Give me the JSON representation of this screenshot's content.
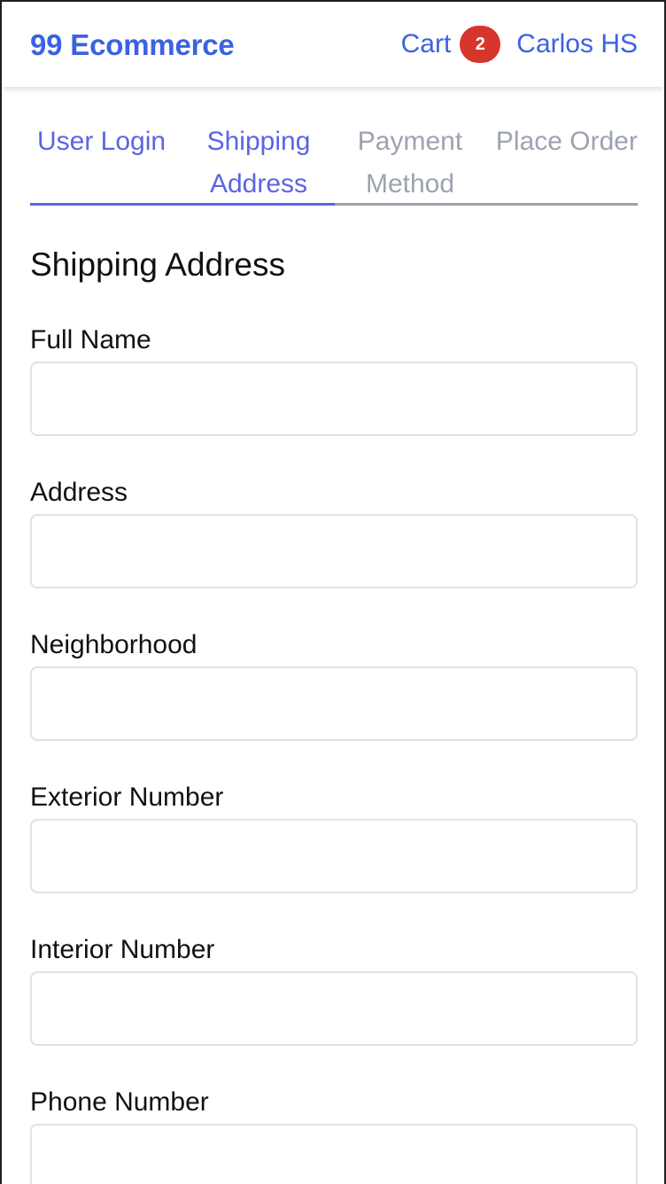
{
  "navbar": {
    "brand": "99 Ecommerce",
    "cart_label": "Cart",
    "cart_count": "2",
    "user_name": "Carlos HS"
  },
  "steps": [
    {
      "label": "User Login",
      "state": "active"
    },
    {
      "label": "Shipping Address",
      "state": "active"
    },
    {
      "label": "Payment Method",
      "state": "inactive"
    },
    {
      "label": "Place Order",
      "state": "inactive"
    }
  ],
  "page": {
    "title": "Shipping Address"
  },
  "form": {
    "fields": [
      {
        "label": "Full Name",
        "value": "",
        "placeholder": ""
      },
      {
        "label": "Address",
        "value": "",
        "placeholder": ""
      },
      {
        "label": "Neighborhood",
        "value": "",
        "placeholder": ""
      },
      {
        "label": "Exterior Number",
        "value": "",
        "placeholder": ""
      },
      {
        "label": "Interior Number",
        "value": "",
        "placeholder": ""
      },
      {
        "label": "Phone Number",
        "value": "",
        "placeholder": ""
      }
    ]
  },
  "colors": {
    "brand_blue": "#3b62e0",
    "active_step": "#5b65e3",
    "inactive_step": "#9ca3af",
    "badge_red": "#d6362b"
  }
}
